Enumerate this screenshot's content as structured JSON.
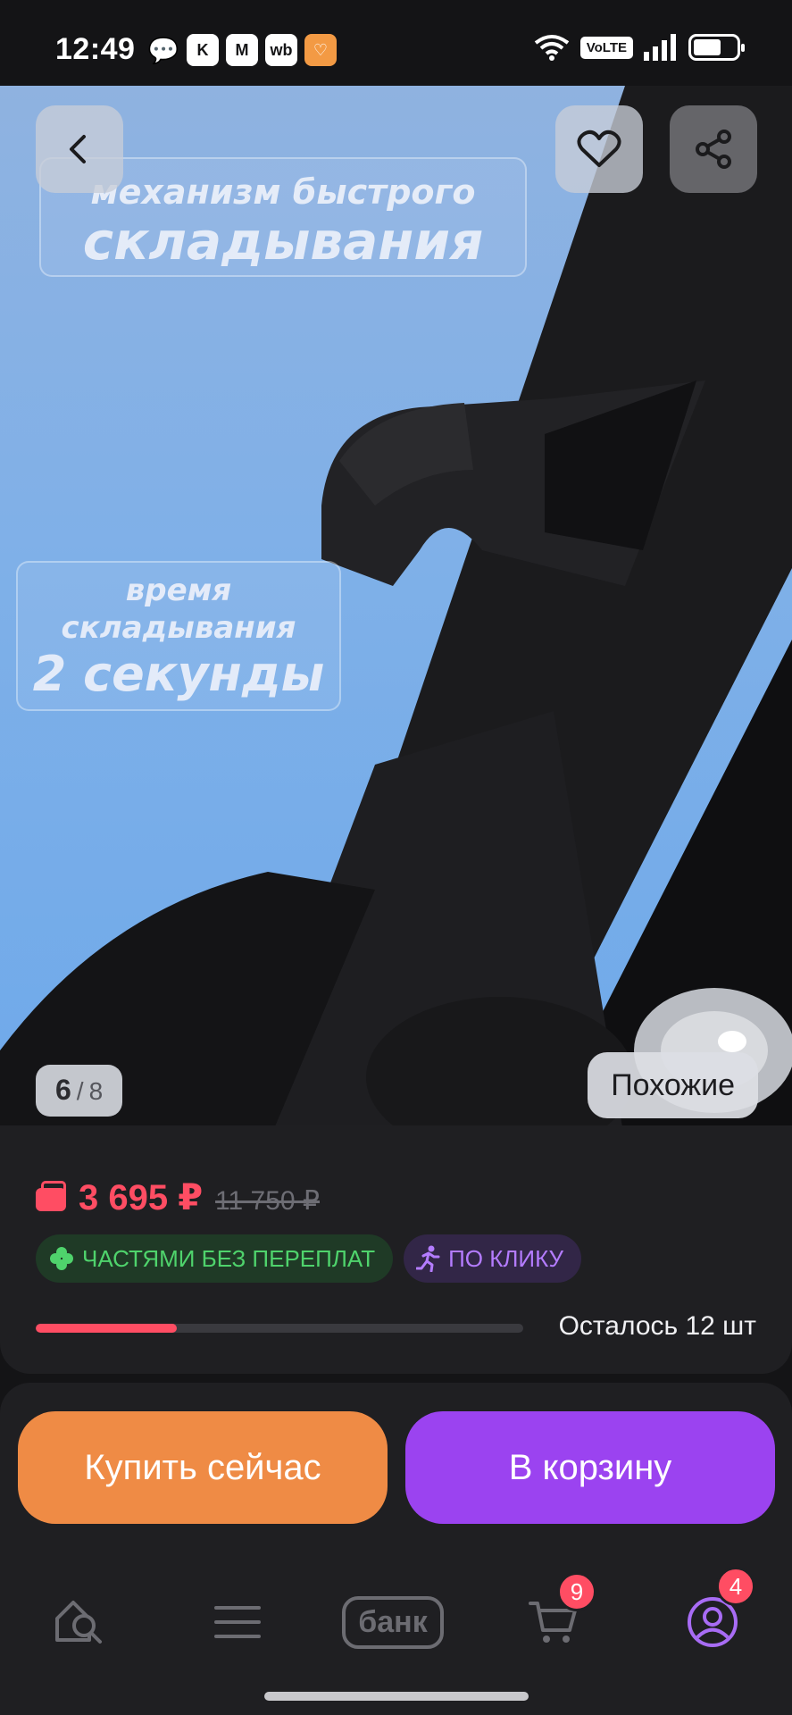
{
  "status_bar": {
    "time": "12:49",
    "notifications": [
      "chat-icon",
      "K",
      "M",
      "wb",
      "heart-app-icon"
    ],
    "volte_label": "VoLTE",
    "battery_level": 0.58
  },
  "hero": {
    "caption_top_line1": "механизм быстрого",
    "caption_top_line2": "складывания",
    "caption_mid_line1": "время",
    "caption_mid_line2": "складывания",
    "caption_mid_line3": "2 секунды",
    "counter_current": "6",
    "counter_separator": "/",
    "counter_total": "8",
    "similar_label": "Похожие"
  },
  "price": {
    "current": "3 695 ₽",
    "old": "11 750 ₽",
    "accent_color": "#ff4d63",
    "badge_installments": "ЧАСТЯМИ БЕЗ ПЕРЕПЛАТ",
    "badge_click": "ПО КЛИКУ",
    "stock_progress": 0.29,
    "stock_text": "Осталось 12 шт"
  },
  "actions": {
    "buy_now": "Купить сейчас",
    "add_to_cart": "В корзину",
    "buy_color": "#ef8b45",
    "cart_color": "#9b43f0"
  },
  "tabbar": {
    "bank_label": "банк",
    "cart_count": "9",
    "profile_count": "4"
  }
}
